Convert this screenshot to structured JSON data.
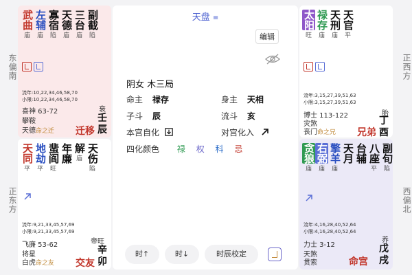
{
  "directions": {
    "left_top": "东偏南",
    "left_bottom": "正东方",
    "right_top": "正西方",
    "right_bottom": "西偏北"
  },
  "cells": {
    "top_left": {
      "stars": [
        {
          "ch": "武曲",
          "br": "庙"
        },
        {
          "ch": "左辅",
          "br": "庙"
        },
        {
          "ch": "寡宿",
          "br": "陷"
        },
        {
          "ch": "天德",
          "br": "庙"
        },
        {
          "ch": "三台",
          "br": "庙"
        },
        {
          "ch": "副截",
          "br": "陷"
        }
      ],
      "daxian": "流年:10,22,34,46,58,70",
      "xiaoxian": "小限:10,22,34,46,58,70",
      "minor1": "喜神 63-72",
      "minor2": "攀鞍",
      "minor3": "天德",
      "shen": "命之迁",
      "palace": "迁移",
      "phase": "衰",
      "stem": "壬辰"
    },
    "top_right": {
      "stars": [
        {
          "ch": "太阳",
          "br": "旺"
        },
        {
          "ch": "禄存",
          "br": "庙"
        },
        {
          "ch": "天刑",
          "br": "庙"
        },
        {
          "ch": "天官",
          "br": "平"
        }
      ],
      "daxian": "流年:3,15,27,39,51,63",
      "xiaoxian": "小限:3,15,27,39,51,63",
      "minor1": "博士 113-122",
      "minor2": "灾煞",
      "minor3": "丧门",
      "shen": "命之兄",
      "palace": "兄弟",
      "phase": "胎",
      "stem": "丁酉"
    },
    "bottom_left": {
      "stars": [
        {
          "ch": "天同",
          "br": "平"
        },
        {
          "ch": "地劫",
          "br": "平"
        },
        {
          "ch": "蜚阎",
          "br": "旺"
        },
        {
          "ch": "年廉",
          "br": ""
        },
        {
          "ch": "解",
          "br": "庙"
        },
        {
          "ch": "天伤",
          "br": "陷"
        }
      ],
      "daxian": "流年:9,21,33,45,57,69",
      "xiaoxian": "小限:9,21,33,45,57,69",
      "minor1": "飞廉 53-62",
      "minor2": "将星",
      "minor3": "白虎",
      "shen": "命之友",
      "palace": "交友",
      "phase": "帝旺",
      "stem": "辛卯"
    },
    "bottom_right": {
      "stars": [
        {
          "ch": "贪狼",
          "br": "庙"
        },
        {
          "ch": "右弼",
          "br": "庙"
        },
        {
          "ch": "擎羊",
          "br": "庙"
        },
        {
          "ch": "天月",
          "br": ""
        },
        {
          "ch": "台辅",
          "br": ""
        },
        {
          "ch": "八座",
          "br": "平"
        },
        {
          "ch": "副旬",
          "br": "陷"
        }
      ],
      "daxian": "流年:4,16,28,40,52,64",
      "xiaoxian": "小限:4,16,28,40,52,64",
      "minor1": "力士 3-12",
      "minor2": "天煞",
      "minor3": "贯索",
      "palace": "命宫",
      "phase": "养",
      "stem": "戊戌"
    }
  },
  "center": {
    "title": "天盘",
    "edit_label": "编辑",
    "gender_bureau": "阴女  木三局",
    "ming_zhu_label": "命主",
    "ming_zhu": "禄存",
    "shen_zhu_label": "身主",
    "shen_zhu": "天相",
    "zi_dou_label": "子斗",
    "zi_dou": "辰",
    "liu_dou_label": "流斗",
    "liu_dou": "亥",
    "ben_gong_label": "本宫自化",
    "dui_gong_label": "对宫化入",
    "sihua_color_label": "四化颜色",
    "sihua_lu": "禄",
    "sihua_quan": "权",
    "sihua_ke": "科",
    "sihua_ji": "忌",
    "btn_time_up": "时↑",
    "btn_time_down": "时↓",
    "btn_calibrate": "时辰校定"
  },
  "colors": {
    "red": "#c2372c",
    "blue": "#2a4fc0",
    "green": "#2f9a52",
    "accent": "#4a5fd0"
  }
}
